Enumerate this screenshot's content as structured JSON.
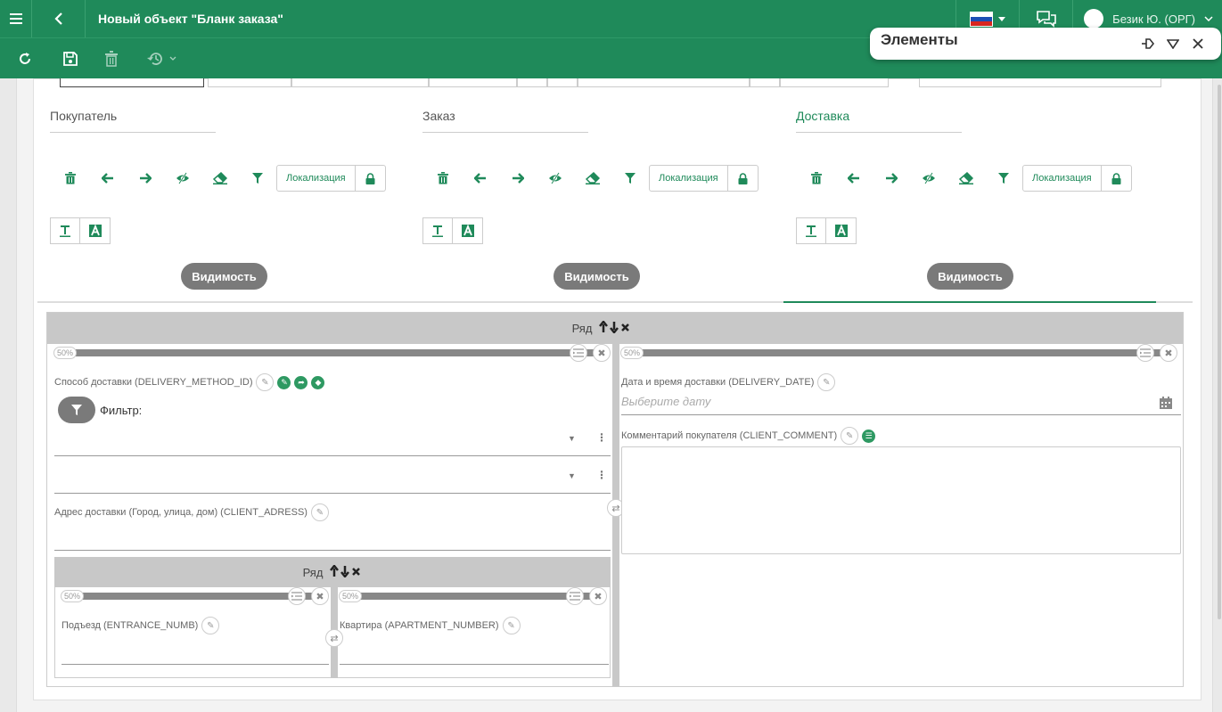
{
  "header": {
    "title": "Новый объект \"Бланк заказа\"",
    "user": "Безик Ю. (ОРГ)"
  },
  "elements_panel": {
    "title": "Элементы"
  },
  "sections": [
    {
      "title": "Покупатель",
      "localization": "Локализация",
      "visibility": "Видимость"
    },
    {
      "title": "Заказ",
      "localization": "Локализация",
      "visibility": "Видимость"
    },
    {
      "title": "Доставка",
      "localization": "Локализация",
      "visibility": "Видимость"
    }
  ],
  "builder": {
    "row_label": "Ряд",
    "nested_row_label": "Ряд",
    "pct": "50%",
    "fields": {
      "delivery_method": "Способ доставки (DELIVERY_METHOD_ID)",
      "filter": "Фильтр:",
      "client_address": "Адрес доставки (Город, улица, дом) (CLIENT_ADRESS)",
      "entrance": "Подъезд (ENTRANCE_NUMB)",
      "apartment": "Квартира (APARTMENT_NUMBER)",
      "delivery_date": "Дата и время доставки (DELIVERY_DATE)",
      "date_placeholder": "Выберите дату",
      "client_comment": "Комментарий покупателя (CLIENT_COMMENT)"
    }
  },
  "colors": {
    "brand": "#1f8a5a",
    "row_header": "#c8c8c8"
  }
}
